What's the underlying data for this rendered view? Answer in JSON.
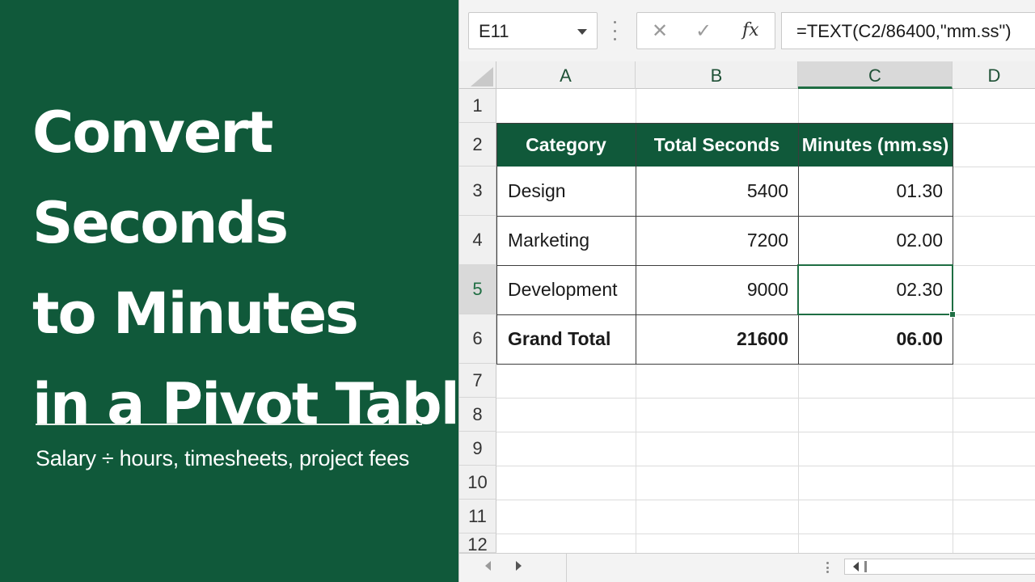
{
  "title_lines": [
    "Convert",
    "Seconds",
    "to Minutes",
    "in a Pivot Table"
  ],
  "subtitle": "Salary ÷ hours, timesheets, project fees",
  "colors": {
    "brand_green": "#10593a",
    "accent_green": "#1f6e43"
  },
  "formula_bar": {
    "name_box": "E11",
    "cancel_icon": "✕",
    "enter_icon": "✓",
    "fx_icon": "fx",
    "formula": "=TEXT(C2/86400,\"mm.ss\")"
  },
  "columns": [
    "A",
    "B",
    "C",
    "D"
  ],
  "selected_column": "C",
  "rows": [
    "1",
    "2",
    "3",
    "4",
    "5",
    "6",
    "7",
    "8",
    "9",
    "10",
    "11",
    "12"
  ],
  "selected_row": "5",
  "table": {
    "headers": [
      "Category",
      "Total Seconds",
      "Minutes (mm.ss)"
    ],
    "rows": [
      {
        "category": "Design",
        "seconds": "5400",
        "minutes": "01.30"
      },
      {
        "category": "Marketing",
        "seconds": "7200",
        "minutes": "02.00"
      },
      {
        "category": "Development",
        "seconds": "9000",
        "minutes": "02.30"
      }
    ],
    "total": {
      "category": "Grand Total",
      "seconds": "21600",
      "minutes": "06.00"
    }
  }
}
